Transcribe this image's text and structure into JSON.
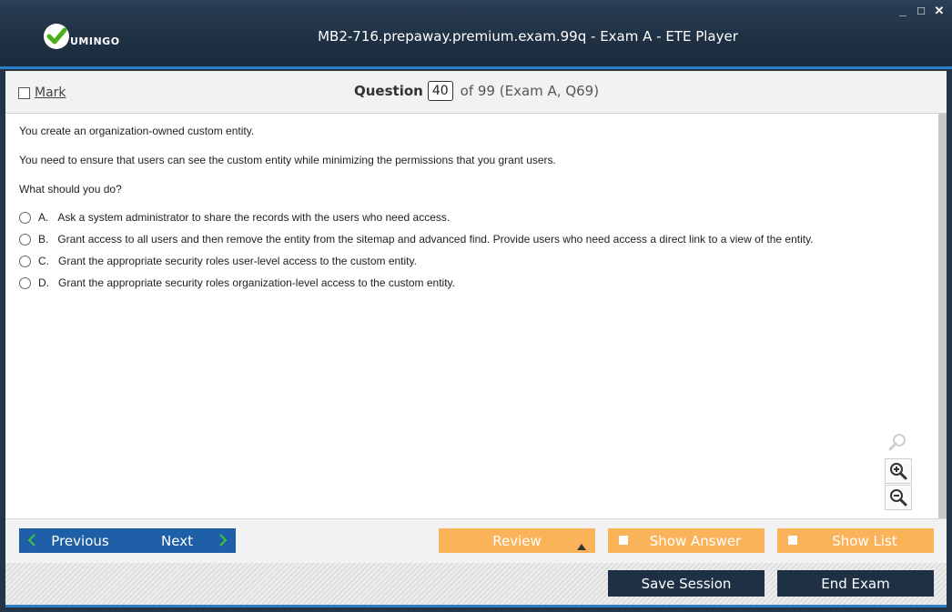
{
  "window": {
    "title": "MB2-716.prepaway.premium.exam.99q - Exam A - ETE Player",
    "logo_text": "UMINGO",
    "controls": {
      "minimize": "_",
      "maximize": "□",
      "close": "✕"
    }
  },
  "subbar": {
    "mark_label": "Mark",
    "question_label": "Question",
    "question_number": "40",
    "question_of": "of 99 (Exam A, Q69)"
  },
  "question": {
    "paragraphs": [
      "You create an organization-owned custom entity.",
      "You need to ensure that users can see the custom entity while minimizing the permissions that you grant users.",
      "What should you do?"
    ],
    "options": [
      {
        "letter": "A.",
        "text": "Ask a system administrator to share the records with the users who need access."
      },
      {
        "letter": "B.",
        "text": "Grant access to all users and then remove the entity from the sitemap and advanced find. Provide users who need access a direct link to a view of the entity."
      },
      {
        "letter": "C.",
        "text": "Grant the appropriate security roles user-level access to the custom entity."
      },
      {
        "letter": "D.",
        "text": "Grant the appropriate security roles organization-level access to the custom entity."
      }
    ]
  },
  "zoom": [
    "search-icon",
    "zoom-in-icon",
    "zoom-out-icon"
  ],
  "nav": {
    "previous": "Previous",
    "next": "Next",
    "review": "Review",
    "show_answer": "Show Answer",
    "show_list": "Show List",
    "save_session": "Save Session",
    "end_exam": "End Exam"
  },
  "colors": {
    "nav_blue": "#1f5fa8",
    "accent_orange": "#fbb35a",
    "dark_navy": "#1f3045",
    "title_bar": "#243547"
  }
}
